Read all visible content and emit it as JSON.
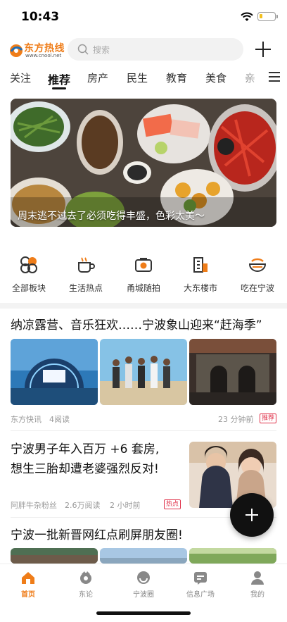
{
  "status": {
    "time": "10:43",
    "battery_level": 0.2
  },
  "header": {
    "logo_text": "东方热线",
    "logo_sub": "www.cnool.net",
    "search_placeholder": "搜索",
    "plus_icon": "plus-icon"
  },
  "tabs": [
    {
      "label": "关注",
      "active": false
    },
    {
      "label": "推荐",
      "active": true
    },
    {
      "label": "房产",
      "active": false
    },
    {
      "label": "民生",
      "active": false
    },
    {
      "label": "教育",
      "active": false
    },
    {
      "label": "美食",
      "active": false
    },
    {
      "label": "亲",
      "active": false
    }
  ],
  "banner": {
    "caption": "周末逃不过去了必须吃得丰盛，色彩太美～"
  },
  "categories": [
    {
      "label": "全部板块",
      "icon": "grid-flower-icon"
    },
    {
      "label": "生活热点",
      "icon": "coffee-cup-icon"
    },
    {
      "label": "甬城随拍",
      "icon": "camera-icon"
    },
    {
      "label": "大东楼市",
      "icon": "building-icon"
    },
    {
      "label": "吃在宁波",
      "icon": "bowl-icon"
    }
  ],
  "articles": [
    {
      "title": "纳凉露营、音乐狂欢……宁波象山迎来“赶海季”",
      "source": "东方快讯",
      "reads": "4阅读",
      "time": "23 分钟前",
      "badge": "推荐"
    },
    {
      "title_line1": "宁波男子年入百万 +6 套房,",
      "title_line2": "想生三胎却遭老婆强烈反对!",
      "source": "阿胖牛杂粉丝",
      "reads": "2.6万阅读",
      "time": "2 小时前",
      "badge": "热点"
    },
    {
      "title": "宁波一批新晋网红点刷屏朋友圈!"
    }
  ],
  "tabbar": [
    {
      "label": "首页",
      "icon": "home-icon",
      "active": true
    },
    {
      "label": "东论",
      "icon": "discussion-icon",
      "active": false
    },
    {
      "label": "宁波圈",
      "icon": "circle-icon",
      "active": false
    },
    {
      "label": "信息广场",
      "icon": "info-square-icon",
      "active": false
    },
    {
      "label": "我的",
      "icon": "profile-icon",
      "active": false
    }
  ],
  "colors": {
    "accent": "#ef7d19",
    "badge_red": "#e0334b"
  }
}
